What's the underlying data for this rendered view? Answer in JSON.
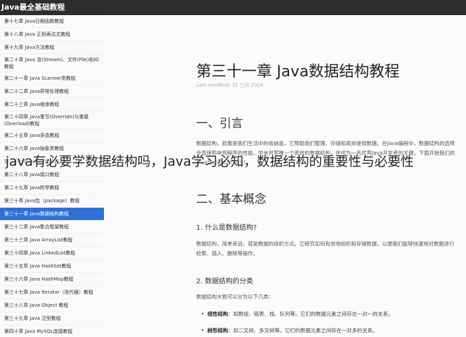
{
  "header": {
    "title": "Java最全基础教程"
  },
  "sidebar": {
    "items": [
      {
        "label": "第十七章 Java日期函数教程"
      },
      {
        "label": "第十八章 Java 正则表达式教程"
      },
      {
        "label": "第十九章 Java方法教程"
      },
      {
        "label": "第二十章 Java 流(Stream)、文件(File)和IO教程"
      },
      {
        "label": "第二十一章 Java Scanner类教程"
      },
      {
        "label": "第二十二章 Java异常处理教程"
      },
      {
        "label": "第二十三章 Java继承教程"
      },
      {
        "label": "第二十四章 Java重写(Override)与重载(Overload)教程"
      },
      {
        "label": "第二十五章 Java多态教程"
      },
      {
        "label": "第二十六章 Java抽象类教程"
      },
      {
        "label": "第二十七章 Java封装教程"
      },
      {
        "label": "第二十八章 Java接口教程"
      },
      {
        "label": "第二十九章 Java枚举教程"
      },
      {
        "label": "第三十章 Java包（package）教程"
      },
      {
        "label": "第三十一章 Java数据结构教程"
      },
      {
        "label": "第三十二章 Java集合框架教程"
      },
      {
        "label": "第三十三章 Java ArrayList教程"
      },
      {
        "label": "第三十四章 Java LinkedList教程"
      },
      {
        "label": "第三十五章 Java HashSet教程"
      },
      {
        "label": "第三十六章 Java HashMap教程"
      },
      {
        "label": "第三十七章 Java Iterator（迭代器）教程"
      },
      {
        "label": "第三十八章 Java Object 教程"
      },
      {
        "label": "第三十九章 Java 泛型教程"
      },
      {
        "label": "第四十章 Java MySQL连接教程"
      }
    ]
  },
  "article": {
    "title": "第三十一章 Java数据结构教程",
    "modified": "Last modified: 31 三月 2024",
    "section1": "一、引言",
    "intro": "数据结构，就像是我们生活中的收纳盒，它帮助我们整理、存储和高效使用数据。在Java编程中，数据结构的选择会直接影响到程序的性能，学会并掌握一个高效的数据结构，是成为一名优秀Java开发者的关键。下面开始我们的Java数据结构之旅吧！",
    "section2": "二、基本概念",
    "q1": "1. 什么是数据结构?",
    "def": "数据结构，简单来说，就是数据的组织方式。它研究如何有效地组织和存储数据，以便我们能够快速地对数据进行检索、插入、删除等操作。",
    "q2": "2. 数据结构的分类",
    "cat_intro": "数据结构大致可以分为以下几类：",
    "bullets": [
      {
        "term": "线性结构",
        "desc": "：如数组、链表、栈、队列等。它们的数据元素之间存在一对一的关系。"
      },
      {
        "term": "树形结构",
        "desc": "：如二叉树、多叉树等。它们的数据元素之间存在一对多的关系。"
      }
    ]
  },
  "overlay": {
    "text": "java有必要学数据结构吗，Java学习必知，数据结构的重要性与必要性"
  }
}
